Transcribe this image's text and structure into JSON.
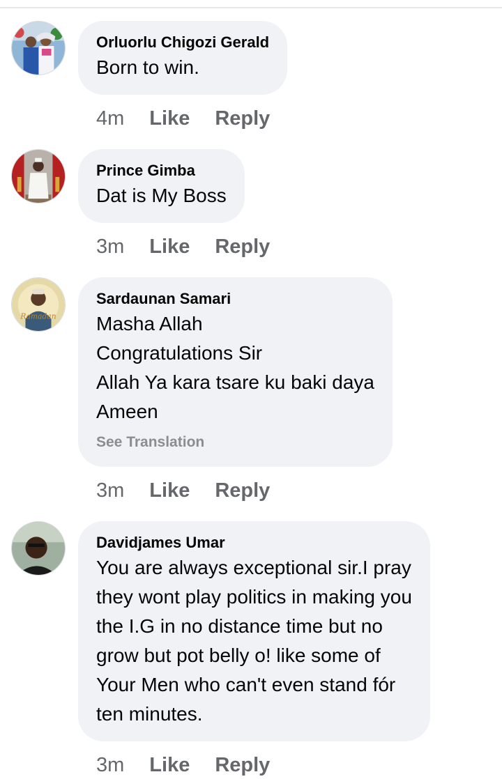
{
  "comments": [
    {
      "author": "Orluorlu Chigozi Gerald",
      "text": "Born to win.",
      "time": "4m",
      "like": "Like",
      "reply": "Reply"
    },
    {
      "author": "Prince Gimba",
      "text": "Dat is My Boss",
      "time": "3m",
      "like": "Like",
      "reply": "Reply"
    },
    {
      "author": "Sardaunan Samari",
      "text": "Masha Allah\nCongratulations Sir\nAllah Ya kara tsare ku baki daya\nAmeen",
      "see_translation": "See Translation",
      "time": "3m",
      "like": "Like",
      "reply": "Reply"
    },
    {
      "author": "Davidjames Umar",
      "text": "You are always exceptional sir.I pray\nthey wont play politics in making you\nthe I.G in no distance time but no\ngrow but pot belly o! like some of\nYour Men who can't even stand fór\nten minutes.",
      "time": "3m",
      "like": "Like",
      "reply": "Reply"
    }
  ],
  "colors": {
    "bubble": "#f0f2f5",
    "meta_text": "#65676b",
    "translation_link": "#8a8d91"
  }
}
